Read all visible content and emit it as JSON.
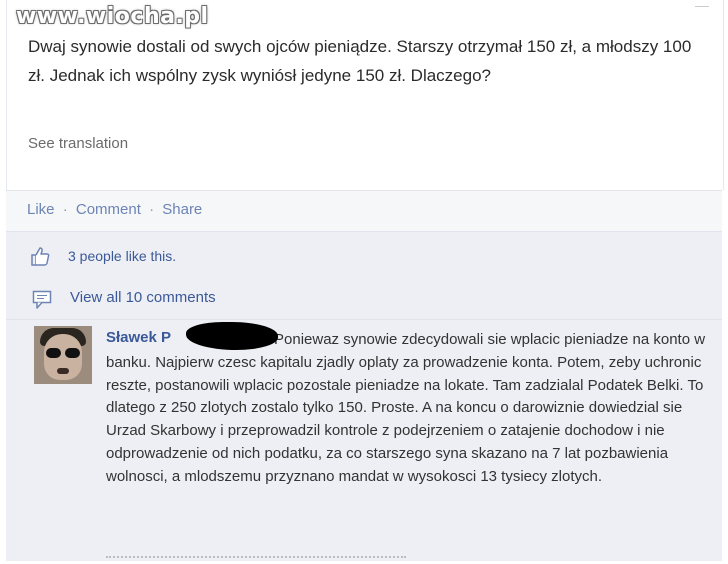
{
  "watermark": {
    "domain": "www.wiocha.pl"
  },
  "post": {
    "text": "Dwaj synowie dostali od swych ojców pieniądze. Starszy otrzymał 150 zł, a młodszy 100 zł. Jednak ich wspólny zysk wyniósł jedyne 150 zł. Dlaczego?",
    "see_translation": "See translation"
  },
  "actions": {
    "like": "Like",
    "comment": "Comment",
    "share": "Share",
    "separator": "·"
  },
  "likes": {
    "text": "3 people like this."
  },
  "comments_link": {
    "text": "View all 10 comments"
  },
  "comment": {
    "author": "Sławek P",
    "text": "Poniewaz synowie zdecydowali sie wplacic pieniadze na konto w banku. Najpierw czesc kapitalu zjadly oplaty za prowadzenie konta. Potem, zeby uchronic reszte, postanowili wplacic pozostale pieniadze na lokate. Tam zadzialal Podatek Belki. To dlatego z 250 zlotych zostalo tylko 150. Proste. A na koncu o darowiznie dowiedzial sie Urzad Skarbowy i przeprowadzil kontrole z podejrzeniem o zatajenie dochodow i nie odprowadzenie od nich podatku, za co starszego syna skazano na 7 lat pozbawienia wolnosci, a mlodszemu przyznano mandat w wysokosci 13 tysiecy zlotych."
  },
  "icons": {
    "thumb": "thumbs-up-icon",
    "comments": "comment-bubble-icon",
    "avatar": "user-avatar"
  },
  "colors": {
    "link": "#3b5998",
    "action": "#6d84b4",
    "panel": "#edeff4",
    "text": "#333333"
  }
}
